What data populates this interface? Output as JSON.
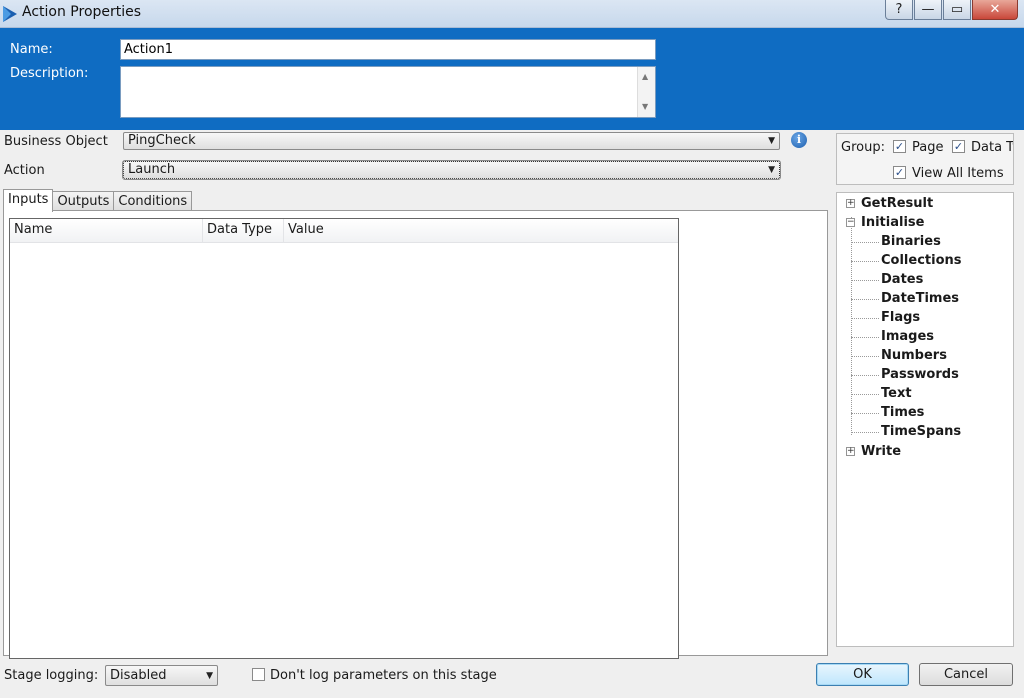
{
  "window": {
    "title": "Action Properties",
    "help_glyph": "?",
    "minimize_glyph": "—",
    "maximize_glyph": "▭",
    "close_glyph": "✕"
  },
  "header": {
    "name_label": "Name:",
    "name_value": "Action1",
    "description_label": "Description:",
    "description_value": ""
  },
  "business_object": {
    "label": "Business Object",
    "value": "PingCheck"
  },
  "action": {
    "label": "Action",
    "value": "Launch"
  },
  "info_glyph": "i",
  "tabs": [
    {
      "label": "Inputs",
      "active": true
    },
    {
      "label": "Outputs",
      "active": false
    },
    {
      "label": "Conditions",
      "active": false
    }
  ],
  "grid": {
    "columns": [
      "Name",
      "Data Type",
      "Value"
    ]
  },
  "group": {
    "label": "Group:",
    "page_label": "Page",
    "page_checked": true,
    "datatype_label": "Data Ty",
    "datatype_checked": true,
    "view_all_label": "View All Items",
    "view_all_checked": true
  },
  "tree": [
    {
      "label": "GetResult",
      "level": 0,
      "expander": "+"
    },
    {
      "label": "Initialise",
      "level": 0,
      "expander": "−"
    },
    {
      "label": "Binaries",
      "level": 1
    },
    {
      "label": "Collections",
      "level": 1
    },
    {
      "label": "Dates",
      "level": 1
    },
    {
      "label": "DateTimes",
      "level": 1
    },
    {
      "label": "Flags",
      "level": 1
    },
    {
      "label": "Images",
      "level": 1
    },
    {
      "label": "Numbers",
      "level": 1
    },
    {
      "label": "Passwords",
      "level": 1
    },
    {
      "label": "Text",
      "level": 1
    },
    {
      "label": "Times",
      "level": 1
    },
    {
      "label": "TimeSpans",
      "level": 1
    },
    {
      "label": "Write",
      "level": 0,
      "expander": "+"
    }
  ],
  "footer": {
    "stage_logging_label": "Stage logging:",
    "stage_logging_value": "Disabled",
    "dont_log_label": "Don't log parameters on this stage",
    "dont_log_checked": false,
    "ok_label": "OK",
    "cancel_label": "Cancel"
  },
  "colors": {
    "header_blue": "#0f6cc2"
  }
}
